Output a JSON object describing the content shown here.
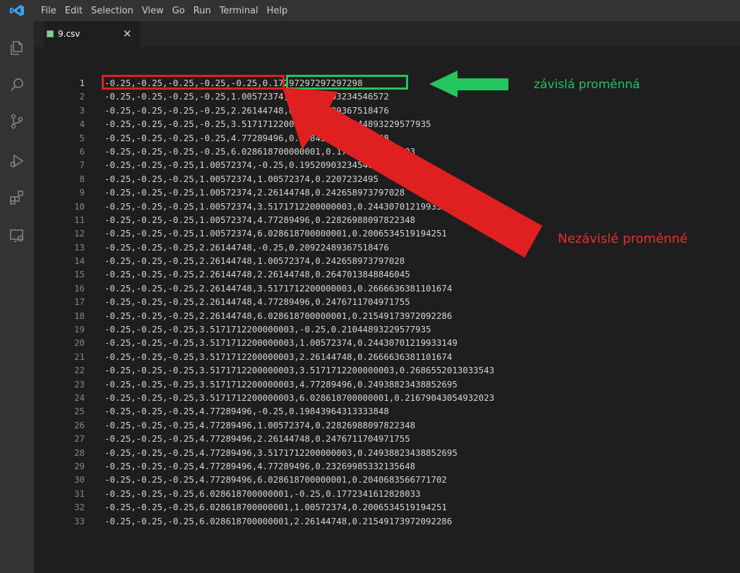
{
  "menu": [
    "File",
    "Edit",
    "Selection",
    "View",
    "Go",
    "Run",
    "Terminal",
    "Help"
  ],
  "tab": {
    "label": "9.csv",
    "close": "✕"
  },
  "annotations": {
    "dependent": "závislá proměnná",
    "independent": "Nezávislé proměnné"
  },
  "colors": {
    "red": "#e02020",
    "green": "#22c55e"
  },
  "icons": [
    "explorer-icon",
    "search-icon",
    "source-control-icon",
    "run-debug-icon",
    "extensions-icon",
    "remote-explorer-icon"
  ],
  "lines": [
    {
      "n": "1",
      "t": "-0.25,-0.25,-0.25,-0.25,-0.25,0.17297297297297298"
    },
    {
      "n": "2",
      "t": "-0.25,-0.25,-0.25,-0.25,1.00572374,0.19520903234546572"
    },
    {
      "n": "3",
      "t": "-0.25,-0.25,-0.25,-0.25,2.26144748,0.20922489367518476"
    },
    {
      "n": "4",
      "t": "-0.25,-0.25,-0.25,-0.25,3.5171712200000003,0.21044893229577935"
    },
    {
      "n": "5",
      "t": "-0.25,-0.25,-0.25,-0.25,4.77289496,0.19843964313333848"
    },
    {
      "n": "6",
      "t": "-0.25,-0.25,-0.25,-0.25,6.028618700000001,0.177234161282803"
    },
    {
      "n": "7",
      "t": "-0.25,-0.25,-0.25,1.00572374,-0.25,0.19520903234546572"
    },
    {
      "n": "8",
      "t": "-0.25,-0.25,-0.25,1.00572374,1.00572374,0.2207232495"
    },
    {
      "n": "9",
      "t": "-0.25,-0.25,-0.25,1.00572374,2.26144748,0.242658973797028"
    },
    {
      "n": "10",
      "t": "-0.25,-0.25,-0.25,1.00572374,3.5171712200000003,0.24430701219933149"
    },
    {
      "n": "11",
      "t": "-0.25,-0.25,-0.25,1.00572374,4.77289496,0.22826988097822348"
    },
    {
      "n": "12",
      "t": "-0.25,-0.25,-0.25,1.00572374,6.028618700000001,0.2006534519194251"
    },
    {
      "n": "13",
      "t": "-0.25,-0.25,-0.25,2.26144748,-0.25,0.20922489367518476"
    },
    {
      "n": "14",
      "t": "-0.25,-0.25,-0.25,2.26144748,1.00572374,0.242658973797028"
    },
    {
      "n": "15",
      "t": "-0.25,-0.25,-0.25,2.26144748,2.26144748,0.2647013848846045"
    },
    {
      "n": "16",
      "t": "-0.25,-0.25,-0.25,2.26144748,3.5171712200000003,0.2666636381101674"
    },
    {
      "n": "17",
      "t": "-0.25,-0.25,-0.25,2.26144748,4.77289496,0.2476711704971755"
    },
    {
      "n": "18",
      "t": "-0.25,-0.25,-0.25,2.26144748,6.028618700000001,0.21549173972092286"
    },
    {
      "n": "19",
      "t": "-0.25,-0.25,-0.25,3.5171712200000003,-0.25,0.21044893229577935"
    },
    {
      "n": "20",
      "t": "-0.25,-0.25,-0.25,3.5171712200000003,1.00572374,0.24430701219933149"
    },
    {
      "n": "21",
      "t": "-0.25,-0.25,-0.25,3.5171712200000003,2.26144748,0.2666636381101674"
    },
    {
      "n": "22",
      "t": "-0.25,-0.25,-0.25,3.5171712200000003,3.5171712200000003,0.2686552013033543"
    },
    {
      "n": "23",
      "t": "-0.25,-0.25,-0.25,3.5171712200000003,4.77289496,0.24938823438852695"
    },
    {
      "n": "24",
      "t": "-0.25,-0.25,-0.25,3.5171712200000003,6.028618700000001,0.21679043054932023"
    },
    {
      "n": "25",
      "t": "-0.25,-0.25,-0.25,4.77289496,-0.25,0.19843964313333848"
    },
    {
      "n": "26",
      "t": "-0.25,-0.25,-0.25,4.77289496,1.00572374,0.22826988097822348"
    },
    {
      "n": "27",
      "t": "-0.25,-0.25,-0.25,4.77289496,2.26144748,0.2476711704971755"
    },
    {
      "n": "28",
      "t": "-0.25,-0.25,-0.25,4.77289496,3.5171712200000003,0.24938823438852695"
    },
    {
      "n": "29",
      "t": "-0.25,-0.25,-0.25,4.77289496,4.77289496,0.23269985332135648"
    },
    {
      "n": "30",
      "t": "-0.25,-0.25,-0.25,4.77289496,6.028618700000001,0.2040683566771702"
    },
    {
      "n": "31",
      "t": "-0.25,-0.25,-0.25,6.028618700000001,-0.25,0.1772341612828033"
    },
    {
      "n": "32",
      "t": "-0.25,-0.25,-0.25,6.028618700000001,1.00572374,0.2006534519194251"
    },
    {
      "n": "33",
      "t": "-0.25,-0.25,-0.25,6.028618700000001,2.26144748,0.21549173972092286"
    }
  ]
}
